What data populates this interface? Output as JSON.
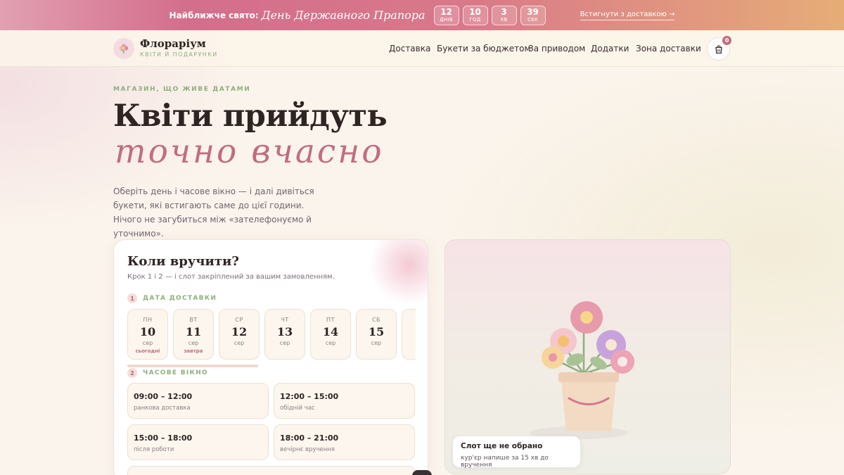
{
  "promo": {
    "label": "Найближче свято:",
    "holiday": "День Державного Прапора",
    "countdown": [
      {
        "value": "12",
        "unit": "ДНІВ"
      },
      {
        "value": "10",
        "unit": "ГОД"
      },
      {
        "value": "3",
        "unit": "ХВ"
      },
      {
        "value": "39",
        "unit": "СЕК"
      }
    ],
    "link": "Встигнути з доставкою →"
  },
  "header": {
    "logo_name": "Флораріум",
    "logo_tagline": "КВІТИ Й ПОДАРУНКИ",
    "nav": [
      "Доставка",
      "Букети за бюджетом",
      "За приводом",
      "Додатки",
      "Зона доставки"
    ],
    "cart_count": "0"
  },
  "hero": {
    "eyebrow": "МАГАЗИН, ЩО ЖИВЕ ДАТАМИ",
    "title": "Квіти прийдуть",
    "title_script": "точно вчасно",
    "lead": "Оберіть день і часове вікно — і далі дивіться букети, які встигають саме до цієї години. Нічого не загубиться між «зателефонуємо й уточнимо»."
  },
  "booking": {
    "title": "Коли вручити?",
    "subtitle": "Крок 1 і 2 — і слот закріплений за вашим замовленням.",
    "step1": {
      "num": "1",
      "label": "ДАТА ДОСТАВКИ"
    },
    "step2": {
      "num": "2",
      "label": "ЧАСОВЕ ВІКНО"
    },
    "days": [
      {
        "wd": "ПН",
        "num": "10",
        "mon": "сер",
        "note": "сьогодні"
      },
      {
        "wd": "ВТ",
        "num": "11",
        "mon": "сер",
        "note": "завтра"
      },
      {
        "wd": "СР",
        "num": "12",
        "mon": "сер",
        "note": ""
      },
      {
        "wd": "ЧТ",
        "num": "13",
        "mon": "сер",
        "note": ""
      },
      {
        "wd": "ПТ",
        "num": "14",
        "mon": "сер",
        "note": ""
      },
      {
        "wd": "СБ",
        "num": "15",
        "mon": "сер",
        "note": ""
      }
    ],
    "slots": [
      {
        "time": "09:00 – 12:00",
        "note": "ранкова доставка"
      },
      {
        "time": "12:00 – 15:00",
        "note": "обідній час"
      },
      {
        "time": "15:00 – 18:00",
        "note": "після роботи"
      },
      {
        "time": "18:00 – 21:00",
        "note": "вечірнє вручення"
      }
    ]
  },
  "preview": {
    "status_title": "Слот ще не обрано",
    "status_sub": "кур'єр напише за 15 хв до вручення"
  },
  "colors": {
    "accent": "#c06d83",
    "green": "#8fae7e",
    "background": "#fbf4ec"
  },
  "icons": {
    "logo": "flower-icon",
    "cart": "shopping-bag-icon"
  }
}
